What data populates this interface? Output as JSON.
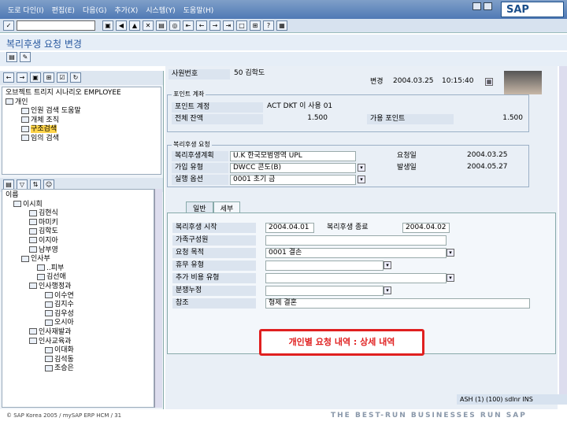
{
  "menu": [
    "도로 다인(I)",
    "편집(E)",
    "다음(G)",
    "추가(X)",
    "시스템(Y)",
    "도움말(H)"
  ],
  "sap_logo": "SAP",
  "title": "복리후생 요청 변경",
  "tree_top": {
    "header": "오브젝트 트리지 시나리오 EMPLOYEE",
    "items": [
      {
        "label": "개인",
        "indent": 0,
        "sel": false
      },
      {
        "label": "인원 검색 도움말",
        "indent": 2,
        "sel": false
      },
      {
        "label": "개체 조직",
        "indent": 2,
        "sel": false
      },
      {
        "label": "구조검색",
        "indent": 2,
        "sel": true
      },
      {
        "label": "임의 검색",
        "indent": 2,
        "sel": false
      }
    ]
  },
  "tree_bottom": {
    "header": "이름",
    "items": [
      {
        "label": "이시희",
        "indent": 1
      },
      {
        "label": "김현식",
        "indent": 3
      },
      {
        "label": "마미키",
        "indent": 3
      },
      {
        "label": "김학도",
        "indent": 3
      },
      {
        "label": "이지아",
        "indent": 3
      },
      {
        "label": "남부영",
        "indent": 3
      },
      {
        "label": "인사부",
        "indent": 2
      },
      {
        "label": "..피부",
        "indent": 4
      },
      {
        "label": "김선애",
        "indent": 4
      },
      {
        "label": "인사행정과",
        "indent": 3
      },
      {
        "label": "이수연",
        "indent": 5
      },
      {
        "label": "김지수",
        "indent": 5
      },
      {
        "label": "김우성",
        "indent": 5
      },
      {
        "label": "오시아",
        "indent": 5
      },
      {
        "label": "인사재발과",
        "indent": 3
      },
      {
        "label": "인사교육과",
        "indent": 3
      },
      {
        "label": "이대화",
        "indent": 5
      },
      {
        "label": "김석동",
        "indent": 5
      },
      {
        "label": "조승은",
        "indent": 5
      }
    ]
  },
  "form": {
    "emp_label": "사원번호",
    "emp_val": "50 김학도",
    "date_label": "변경",
    "date_val": "2004.03.25",
    "time_val": "10:15:40",
    "point_title": "포인트 계좌",
    "point_acct_label": "포인트 계정",
    "point_acct_val": "ACT DKT 이 사용 01",
    "total_label": "전체 잔액",
    "total_val": "1.500",
    "avail_label": "가용 포인트",
    "avail_val": "1.500",
    "req_title": "복리후생 요청",
    "plan_label": "복리후생계획",
    "plan_val": "U.K 한국모범영역 UPL",
    "opt_label": "가입 유형",
    "opt_val": "DWCC 콘도(B)",
    "type_label": "실행 옵션",
    "type_val": "0001 초기 금",
    "reqdate_label": "요청일",
    "reqdate_val": "2004.03.25",
    "procdate_label": "발생일",
    "procdate_val": "2004.05.27"
  },
  "tabs": [
    "일반",
    "세부"
  ],
  "detail": {
    "start_label": "복리후생 시작",
    "start_val": "2004.04.01",
    "end_label": "복리후생 종료",
    "end_val": "2004.04.02",
    "family_label": "가족구성원",
    "reason_label": "요청 목적",
    "reason_val": "0001 결손",
    "b_type_label": "휴무 유형",
    "cost_label": "추가 비용 유형",
    "etc_label": "분쟁누정",
    "ref_label": "참조",
    "ref_val": "형제 결혼"
  },
  "callout": "개인별 요청 내역 : 상세 내역",
  "status": "ASH (1) (100)  sdlnr  INS",
  "footer_left": "© SAP Korea 2005 / mySAP ERP HCM / 31",
  "footer_right": "THE BEST-RUN BUSINESSES RUN SAP"
}
